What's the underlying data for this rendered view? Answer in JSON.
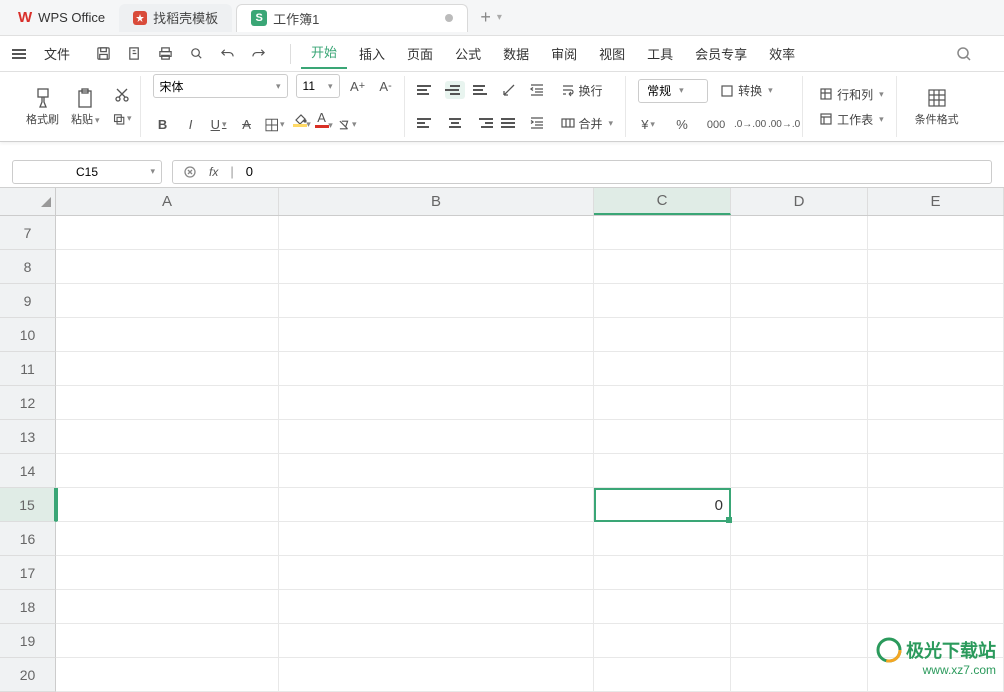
{
  "title_bar": {
    "app_name": "WPS Office",
    "tab_template": "找稻壳模板",
    "tab_workbook": "工作簿1"
  },
  "menu": {
    "file": "文件",
    "start": "开始",
    "insert": "插入",
    "page": "页面",
    "formula": "公式",
    "data": "数据",
    "review": "审阅",
    "view": "视图",
    "tool": "工具",
    "member": "会员专享",
    "efficiency": "效率"
  },
  "ribbon": {
    "format_brush": "格式刷",
    "paste": "粘贴",
    "font_name": "宋体",
    "font_size": "11",
    "wrap": "换行",
    "merge": "合并",
    "number_format": "常规",
    "convert": "转换",
    "row_col": "行和列",
    "worksheet": "工作表",
    "cond_format": "条件格式"
  },
  "name_box": "C15",
  "formula_value": "0",
  "columns": [
    "A",
    "B",
    "C",
    "D",
    "E"
  ],
  "selected_col": "C",
  "rows": [
    7,
    8,
    9,
    10,
    11,
    12,
    13,
    14,
    15,
    16,
    17,
    18,
    19,
    20
  ],
  "selected_row": 15,
  "cell_value": "0",
  "watermark": {
    "line1": "极光下载站",
    "line2": "www.xz7.com"
  }
}
